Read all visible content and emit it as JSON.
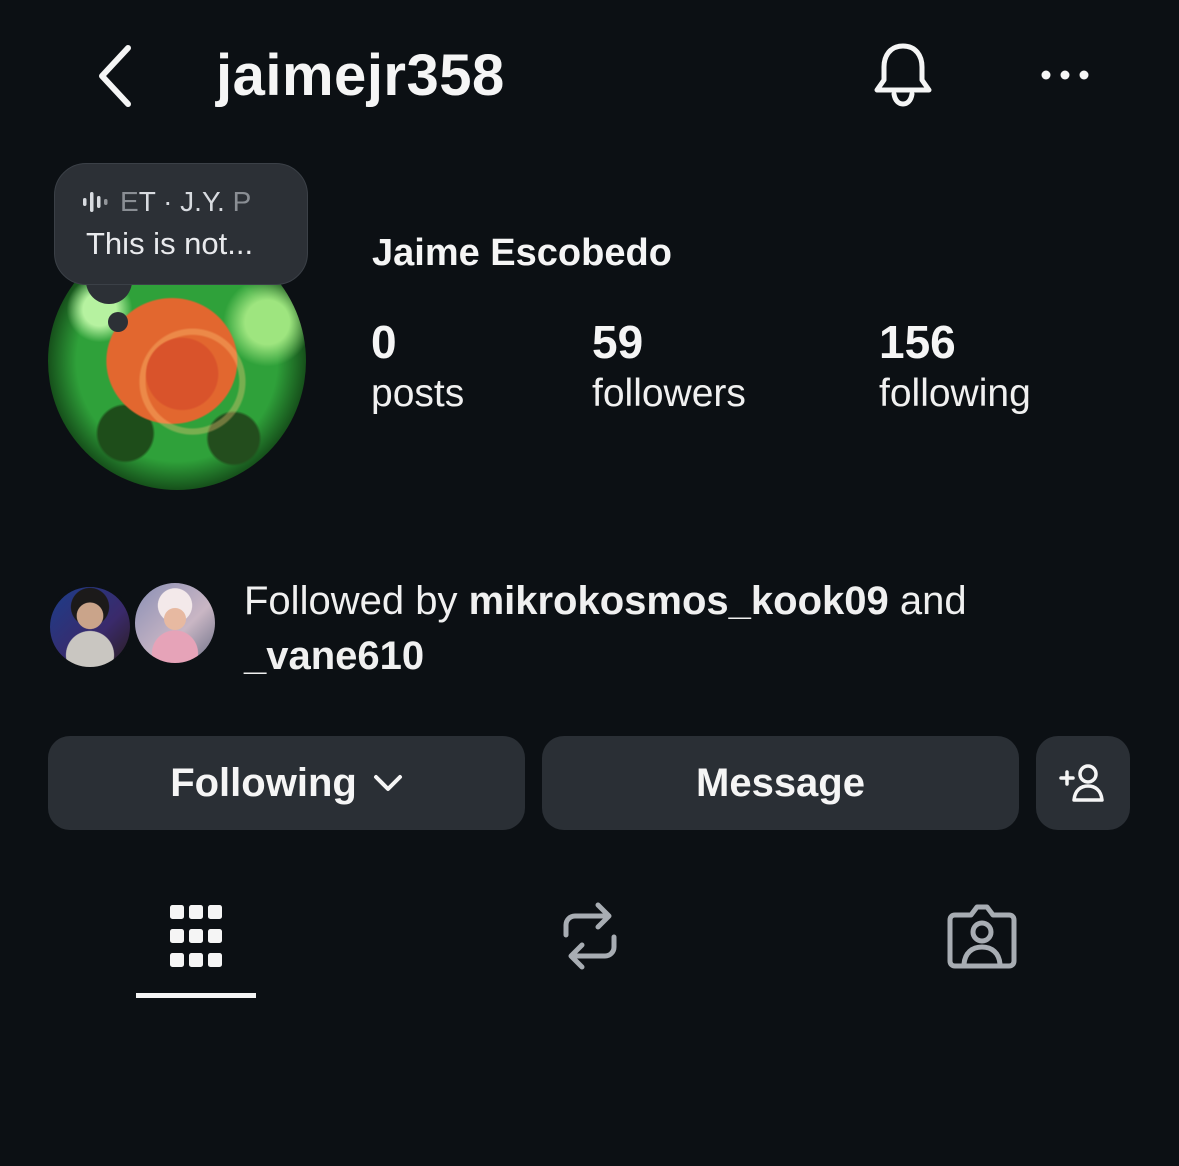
{
  "header": {
    "username": "jaimejr358",
    "back_icon": "chevron-left-icon",
    "bell_icon": "bell-icon",
    "more_icon": "more-horizontal-icon"
  },
  "profile": {
    "full_name": "Jaime Escobedo",
    "note": {
      "music_icon": "audio-wave-icon",
      "music_title_faded_start": "E",
      "music_title": "T · J.Y. ",
      "music_title_faded_end": "P",
      "text": "This is not..."
    },
    "stats": [
      {
        "value": "0",
        "label": "posts"
      },
      {
        "value": "59",
        "label": "followers"
      },
      {
        "value": "156",
        "label": "following"
      }
    ]
  },
  "followed_by": {
    "prefix": "Followed by ",
    "user1": "mikrokosmos_kook09",
    "conjunction": " and",
    "user2": "_vane610"
  },
  "actions": {
    "following_label": "Following",
    "following_icon": "chevron-down-icon",
    "message_label": "Message",
    "add_user_icon": "add-person-icon"
  },
  "tabs": {
    "grid_icon": "grid-icon",
    "reposts_icon": "repost-icon",
    "tagged_icon": "tagged-person-icon",
    "active": "grid"
  },
  "colors": {
    "background": "#0c1014",
    "button": "#2a2f35",
    "text": "#f5f5f5",
    "icon_muted": "#a8adb3"
  }
}
